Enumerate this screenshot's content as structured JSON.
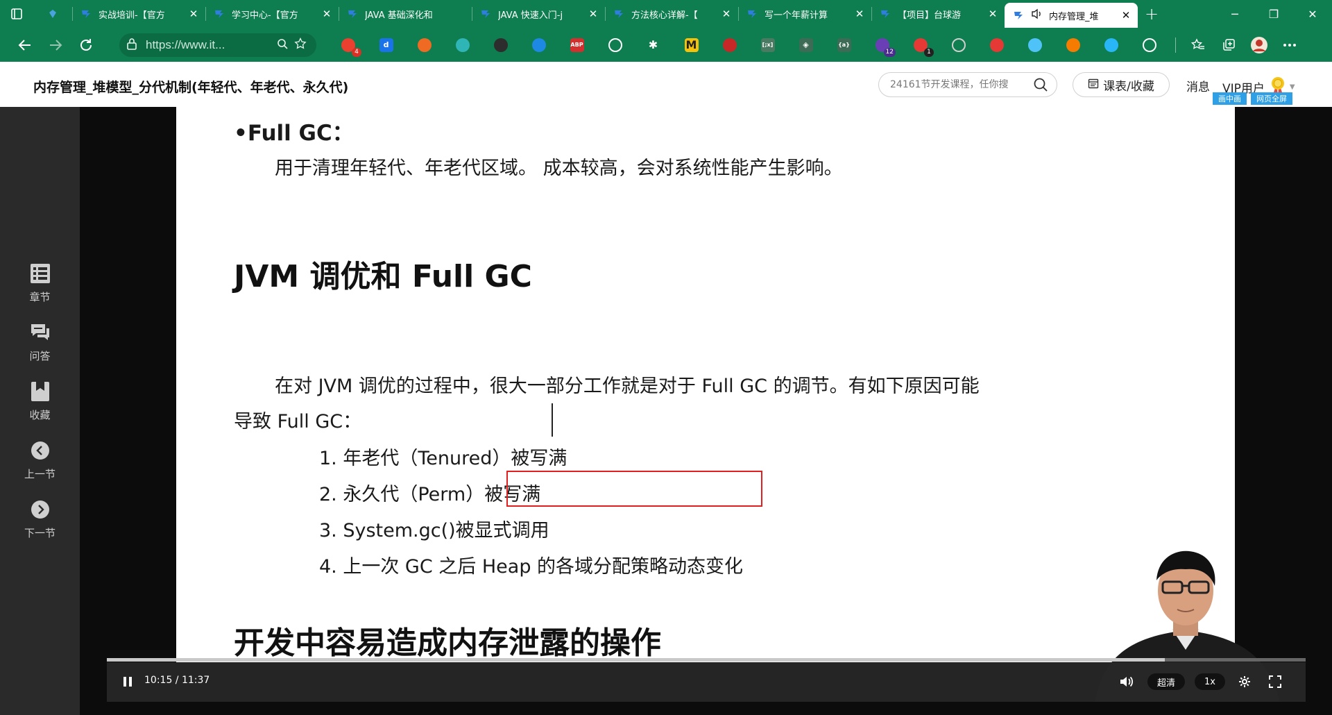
{
  "browser": {
    "tabs": [
      {
        "title": "",
        "pinned": true
      },
      {
        "title": "实战培训-【官方",
        "pinned": false
      },
      {
        "title": "学习中心-【官方",
        "pinned": false
      },
      {
        "title": "JAVA 基础深化和",
        "pinned": false
      },
      {
        "title": "JAVA 快速入门-j",
        "pinned": false
      },
      {
        "title": "方法核心详解-【",
        "pinned": false
      },
      {
        "title": "写一个年薪计算",
        "pinned": false
      },
      {
        "title": "【项目】台球游",
        "pinned": false
      },
      {
        "title": "内存管理_堆",
        "pinned": false,
        "active": true
      }
    ],
    "new_tab_label": "+",
    "window_controls": {
      "minimize": "─",
      "restore": "❐",
      "close": "✕"
    },
    "address": "https://www.it...",
    "extensions": [
      {
        "name": "tampermonkey-icon",
        "label": "",
        "color": "#e9402f",
        "badge": "4",
        "badge_color": "#d93025"
      },
      {
        "name": "dict-extension-icon",
        "label": "d",
        "color": "#1a73e8",
        "badge": "",
        "badge_color": ""
      },
      {
        "name": "notes-extension-icon",
        "label": "",
        "color": "#ef6a23",
        "badge": "",
        "badge_color": ""
      },
      {
        "name": "apps-extension-icon",
        "label": "",
        "color": "#2fb5b5",
        "badge": "",
        "badge_color": ""
      },
      {
        "name": "calculator-extension-icon",
        "label": "",
        "color": "#2d2d2d",
        "badge": "",
        "badge_color": ""
      },
      {
        "name": "diamond-extension-icon",
        "label": "",
        "color": "#1e88e5",
        "badge": "",
        "badge_color": ""
      },
      {
        "name": "adblock-plus-icon",
        "label": "ABP",
        "color": "#d32f2f",
        "badge": "",
        "badge_color": ""
      },
      {
        "name": "mountain-extension-icon",
        "label": "",
        "color": "#ffffff",
        "badge": "",
        "badge_color": ""
      },
      {
        "name": "asterisk-extension-icon",
        "label": "✱",
        "color": "#ffffff",
        "badge": "",
        "badge_color": ""
      },
      {
        "name": "m-extension-icon",
        "label": "M",
        "color": "#f4c20d",
        "badge": "",
        "badge_color": ""
      },
      {
        "name": "blocker-extension-icon",
        "label": "",
        "color": "#c62828",
        "badge": "",
        "badge_color": ""
      },
      {
        "name": "bracket-extension-icon",
        "label": "[;x]",
        "color": "#4a7a62",
        "badge": "",
        "badge_color": ""
      },
      {
        "name": "gem-extension-icon",
        "label": "◈",
        "color": "#3d6b55",
        "badge": "",
        "badge_color": ""
      },
      {
        "name": "code-extension-icon",
        "label": "{a}",
        "color": "#3d6b55",
        "badge": "",
        "badge_color": ""
      },
      {
        "name": "hat-extension-icon",
        "label": "",
        "color": "#6a3fb5",
        "badge": "12",
        "badge_color": "#4b2c8f"
      },
      {
        "name": "pinwheel-extension-icon",
        "label": "",
        "color": "#e53935",
        "badge": "1",
        "badge_color": "#222222"
      },
      {
        "name": "camera-extension-icon",
        "label": "",
        "color": "#cfcfcf",
        "badge": "",
        "badge_color": ""
      },
      {
        "name": "opera-extension-icon",
        "label": "",
        "color": "#e53935",
        "badge": "",
        "badge_color": ""
      },
      {
        "name": "ring-extension-icon",
        "label": "",
        "color": "#4fc3f7",
        "badge": "",
        "badge_color": ""
      },
      {
        "name": "fox-extension-icon",
        "label": "",
        "color": "#f57c00",
        "badge": "",
        "badge_color": ""
      },
      {
        "name": "shield-extension-icon",
        "label": "",
        "color": "#29b6f6",
        "badge": "",
        "badge_color": ""
      },
      {
        "name": "puzzle-extension-icon",
        "label": "",
        "color": "#ffffff",
        "badge": "",
        "badge_color": ""
      }
    ]
  },
  "header": {
    "course_title": "内存管理_堆模型_分代机制(年轻代、年老代、永久代)",
    "search_placeholder": "24161节开发课程，任你搜",
    "favorites_label": "课表/收藏",
    "messages_label": "消息",
    "user_label": "VIP用户",
    "mode_buttons": [
      "画中画",
      "网页全屏"
    ]
  },
  "sidebar": {
    "items": [
      {
        "label": "章节",
        "icon": "chapter-list-icon"
      },
      {
        "label": "问答",
        "icon": "qa-chat-icon"
      },
      {
        "label": "收藏",
        "icon": "bookmark-icon"
      },
      {
        "label": "上一节",
        "icon": "previous-icon"
      },
      {
        "label": "下一节",
        "icon": "next-icon"
      }
    ]
  },
  "slide": {
    "bullet_title": "•Full GC：",
    "bullet_desc": "用于清理年轻代、年老代区域。 成本较高，会对系统性能产生影响。",
    "section_heading": "JVM 调优和 Full GC",
    "paragraph_line1": "在对 JVM 调优的过程中，很大一部分工作就是对于 Full GC 的调节。有如下原因可能",
    "paragraph_line2": "导致 Full GC：",
    "reasons": [
      "1. 年老代（Tenured）被写满",
      "2. 永久代（Perm）被写满",
      "3. System.gc()被显式调用",
      "4. 上一次 GC 之后 Heap 的各域分配策略动态变化"
    ],
    "bottom_heading": "开发中容易造成内存泄露的操作"
  },
  "player": {
    "time_display": "10:15 / 11:37",
    "current_seconds": 615,
    "duration_seconds": 697,
    "quality_label": "超清",
    "speed_label": "1x"
  },
  "colors": {
    "browser_green": "#0e7d4f",
    "highlight_red": "#e02020",
    "mode_button_blue": "#2fa0e6"
  }
}
